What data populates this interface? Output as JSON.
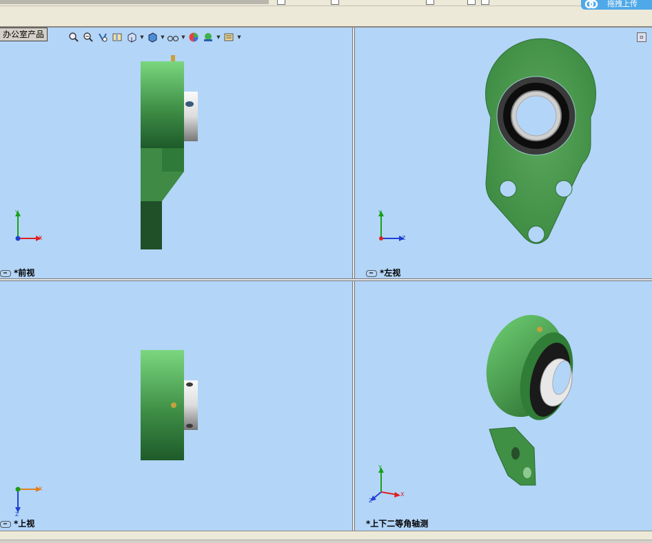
{
  "top": {
    "upload_label": "拖拽上传"
  },
  "tab": {
    "label": "办公室产品"
  },
  "toolbar": {
    "icons": [
      "zoom-to-fit-icon",
      "zoom-area-icon",
      "previous-view-icon",
      "section-view-icon",
      "view-orientation-icon",
      "display-style-icon",
      "hide-show-items-icon",
      "edit-appearance-icon",
      "apply-scene-icon",
      "view-settings-icon"
    ]
  },
  "viewports": {
    "front": {
      "label": "*前视",
      "axis_h": "X",
      "axis_v": "Y"
    },
    "left": {
      "label": "*左视",
      "axis_h": "Z",
      "axis_v": "Y"
    },
    "top": {
      "label": "*上视",
      "axis_h": "X",
      "axis_v": "Z"
    },
    "iso": {
      "label": "*上下二等角轴测",
      "axis_x": "X",
      "axis_y": "Y",
      "axis_z": "Z"
    }
  },
  "colors": {
    "viewport_bg": "#b3d5f8",
    "part_green": "#4f9a4f",
    "part_green_light": "#74d27a",
    "part_green_dark": "#1f5a2a",
    "axis_red": "#e02020",
    "axis_green": "#18a018",
    "axis_blue": "#2040d0"
  }
}
